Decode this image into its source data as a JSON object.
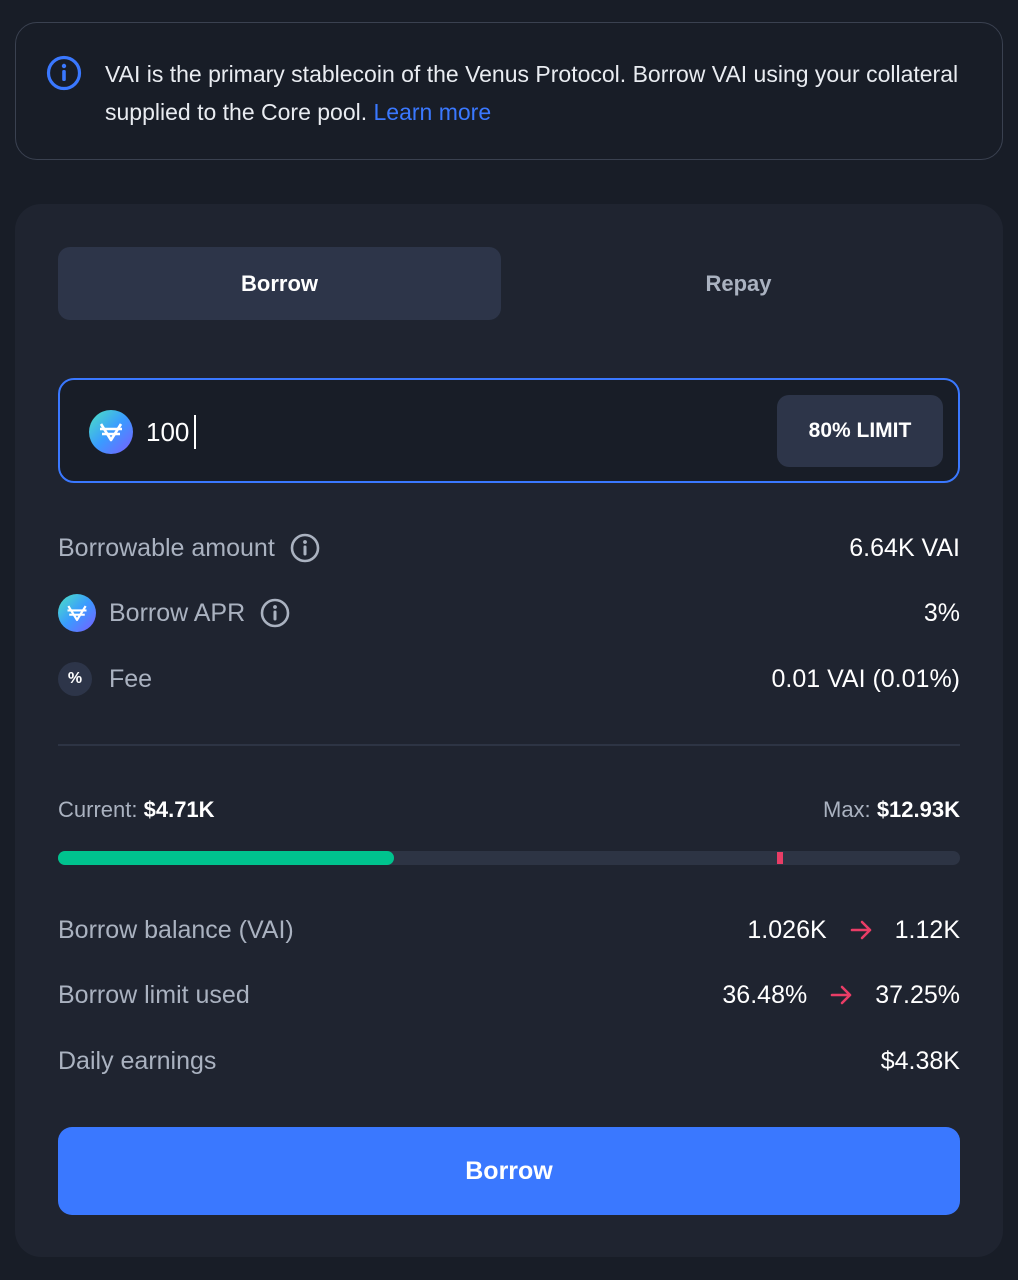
{
  "notice": {
    "text": "VAI is the primary stablecoin of the Venus Protocol. Borrow VAI using your collateral supplied to the Core pool.",
    "link": "Learn more"
  },
  "tabs": {
    "borrow": "Borrow",
    "repay": "Repay"
  },
  "input": {
    "value": "100",
    "limit_button": "80% LIMIT"
  },
  "stats": {
    "borrowable": {
      "label": "Borrowable amount",
      "value": "6.64K VAI"
    },
    "apr": {
      "label": "Borrow APR",
      "value": "3%"
    },
    "fee": {
      "label": "Fee",
      "value": "0.01 VAI (0.01%)",
      "icon_glyph": "%"
    }
  },
  "limit": {
    "current_label": "Current:",
    "current_value": "$4.71K",
    "max_label": "Max:",
    "max_value": "$12.93K",
    "progress_fraction": 0.3725,
    "safe_limit_fraction": 0.8
  },
  "summary": {
    "borrow_balance": {
      "label": "Borrow balance (VAI)",
      "from": "1.026K",
      "to": "1.12K"
    },
    "limit_used": {
      "label": "Borrow limit used",
      "from": "36.48%",
      "to": "37.25%"
    },
    "daily_earnings": {
      "label": "Daily earnings",
      "value": "$4.38K"
    }
  },
  "submit_button": "Borrow",
  "colors": {
    "accent": "#3a78ff",
    "progress": "#00c38e",
    "warning": "#e93d66"
  }
}
